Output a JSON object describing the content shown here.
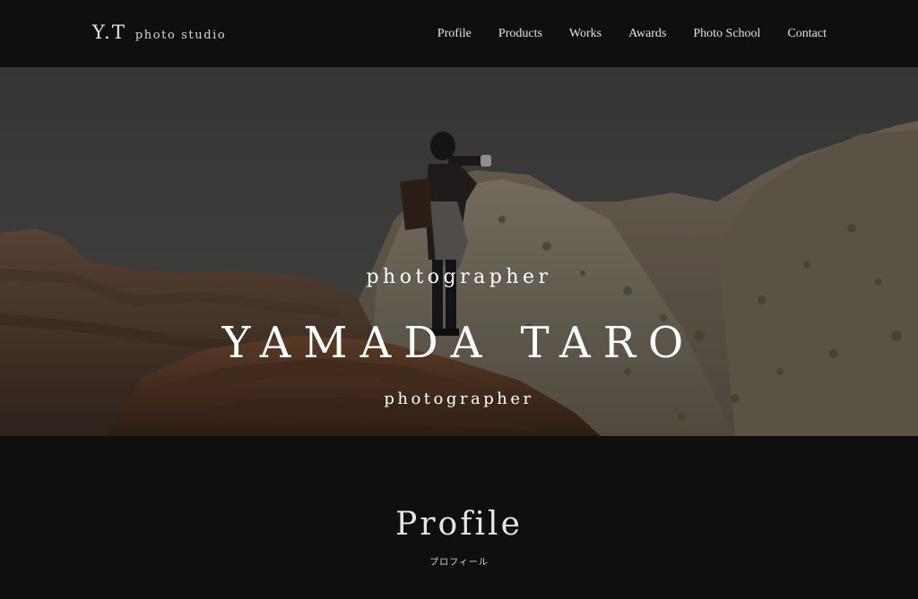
{
  "header": {
    "logo_mark": "Y.T",
    "logo_sub": "photo studio",
    "nav": [
      "Profile",
      "Products",
      "Works",
      "Awards",
      "Photo School",
      "Contact"
    ]
  },
  "hero": {
    "role_top": "photographer",
    "name": "YAMADA TARO",
    "role_bottom": "photographer"
  },
  "profile": {
    "title": "Profile",
    "subtitle": "プロフィール"
  }
}
